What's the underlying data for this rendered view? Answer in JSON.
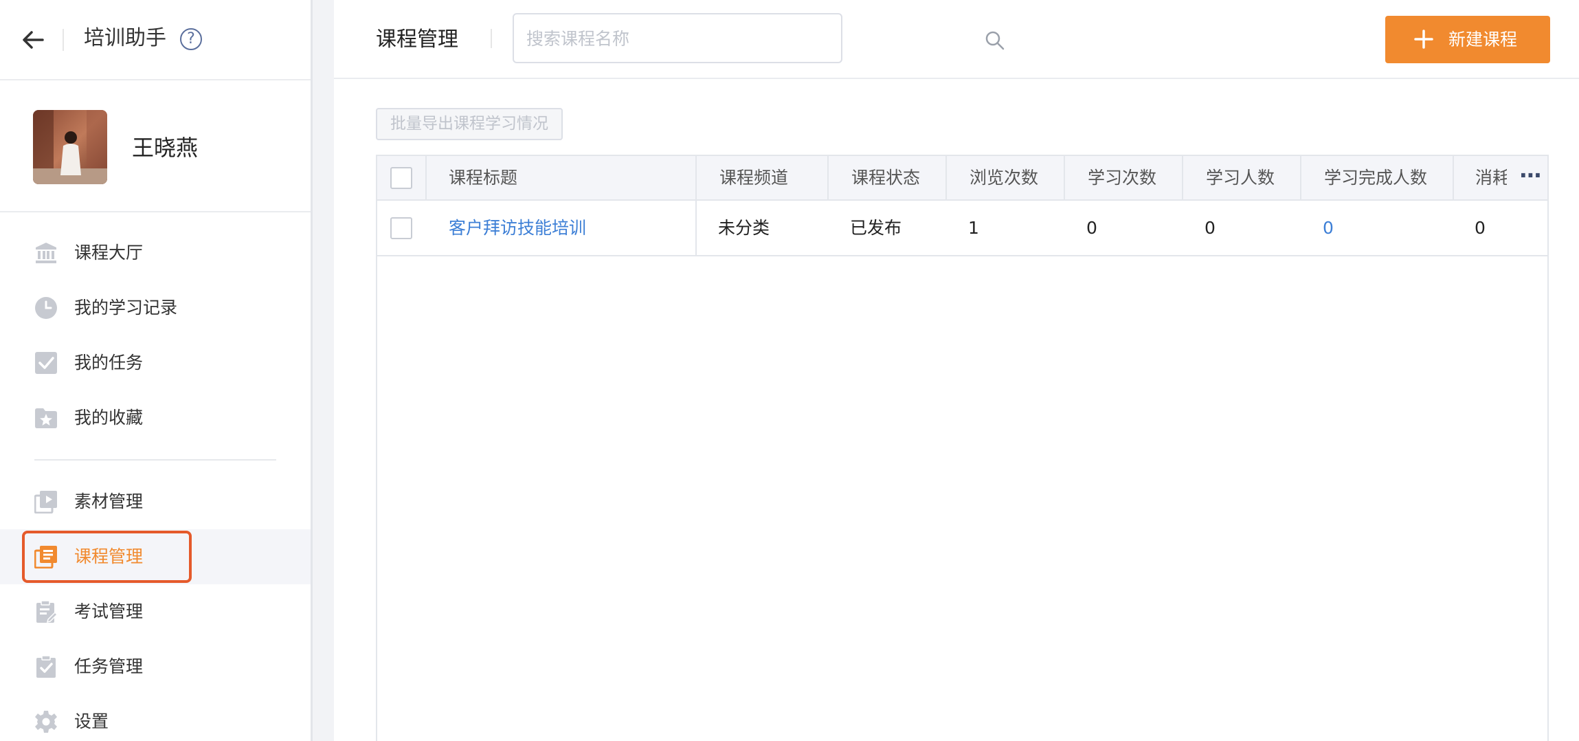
{
  "sidebar": {
    "app_title": "培训助手",
    "help_glyph": "?",
    "user_name": "王晓燕",
    "nav_group1": [
      {
        "label": "课程大厅",
        "icon": "bank-icon"
      },
      {
        "label": "我的学习记录",
        "icon": "clock-icon"
      },
      {
        "label": "我的任务",
        "icon": "checkbox-icon"
      },
      {
        "label": "我的收藏",
        "icon": "star-folder-icon"
      }
    ],
    "nav_group2": [
      {
        "label": "素材管理",
        "icon": "media-icon"
      },
      {
        "label": "课程管理",
        "icon": "course-icon",
        "active": true
      },
      {
        "label": "考试管理",
        "icon": "exam-icon"
      },
      {
        "label": "任务管理",
        "icon": "task-icon"
      },
      {
        "label": "设置",
        "icon": "gear-icon"
      }
    ]
  },
  "header": {
    "page_title": "课程管理",
    "search_placeholder": "搜索课程名称",
    "new_button_label": "新建课程"
  },
  "toolbar": {
    "export_label": "批量导出课程学习情况"
  },
  "table": {
    "columns": [
      "课程标题",
      "课程频道",
      "课程状态",
      "浏览次数",
      "学习次数",
      "学习人数",
      "学习完成人数",
      "消耗"
    ],
    "more_glyph": "⋯",
    "rows": [
      {
        "title": "客户拜访技能培训",
        "channel": "未分类",
        "status": "已发布",
        "views": "1",
        "study_count": "0",
        "learners": "0",
        "completed": "0",
        "consumed": "0"
      }
    ]
  },
  "colors": {
    "accent": "#f18a2f",
    "link": "#3d7fd6",
    "highlight_border": "#e55a2b",
    "icon_gray": "#c7cad1"
  }
}
